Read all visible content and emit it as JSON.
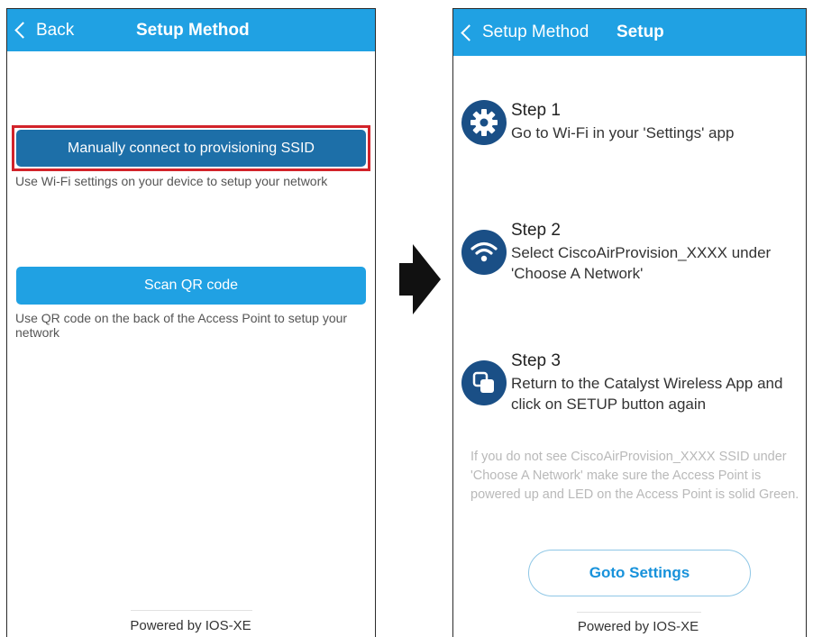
{
  "left": {
    "nav": {
      "back_label": "Back",
      "title": "Setup Method"
    },
    "manual_button_label": "Manually connect to provisioning SSID",
    "manual_helper": "Use Wi-Fi settings on your device to setup your network",
    "qr_button_label": "Scan QR code",
    "qr_helper": "Use QR code on the back of the Access Point to setup your network",
    "footer": "Powered by IOS-XE"
  },
  "right": {
    "nav": {
      "back_label": "Setup Method",
      "title": "Setup"
    },
    "steps": [
      {
        "title": "Step 1",
        "text": "Go to Wi-Fi in your 'Settings' app",
        "icon": "gear-icon"
      },
      {
        "title": "Step 2",
        "text": "Select CiscoAirProvision_XXXX under 'Choose A Network'",
        "icon": "wifi-icon"
      },
      {
        "title": "Step 3",
        "text": "Return to the Catalyst Wireless App and click on SETUP button again",
        "icon": "app-switch-icon"
      }
    ],
    "note": "If you do not see CiscoAirProvision_XXXX SSID under 'Choose A Network' make sure the Access Point is powered up and LED on the Access Point is solid Green.",
    "goto_button_label": "Goto Settings",
    "footer": "Powered by IOS-XE"
  },
  "colors": {
    "nav_blue": "#20a1e3",
    "highlight_red": "#d2232a",
    "step_icon_blue": "#1a4f86",
    "arrow": "#111111"
  }
}
